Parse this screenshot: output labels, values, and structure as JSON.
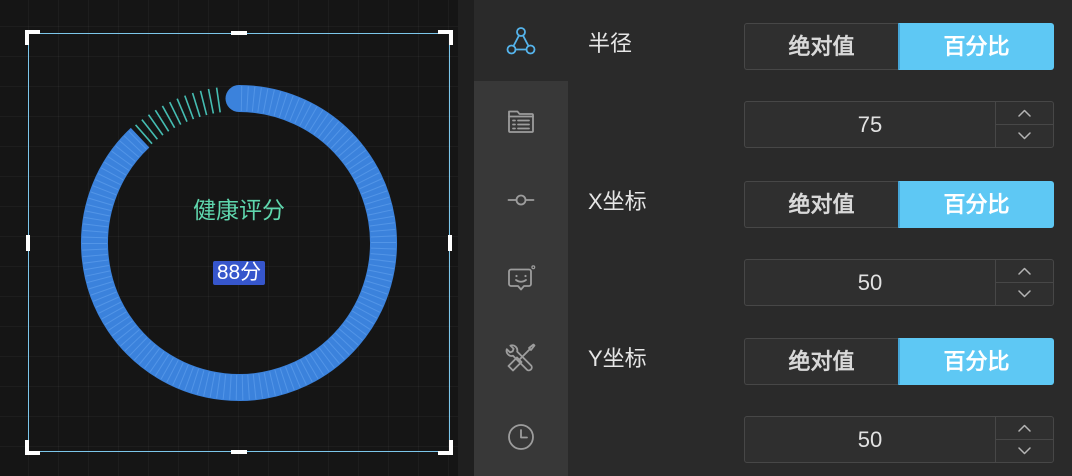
{
  "canvas": {
    "gauge": {
      "label": "健康评分",
      "value_text": "88分",
      "fill_percent": 88,
      "fill_color": "#3b82dc",
      "stripe_color": "#6aa8f2",
      "remainder_color": "#45bdb2",
      "label_color": "#5fd6ad",
      "value_highlight_color": "#3656cc"
    },
    "selection_color": "#7cc6ea"
  },
  "sidebar": {
    "tabs": [
      {
        "icon": "share-nodes-icon",
        "active": true
      },
      {
        "icon": "file-list-icon",
        "active": false
      },
      {
        "icon": "commit-icon",
        "active": false
      },
      {
        "icon": "chat-smile-icon",
        "active": false
      },
      {
        "icon": "tools-icon",
        "active": false
      },
      {
        "icon": "clock-icon",
        "active": false
      }
    ],
    "active_icon_color": "#55b4ec",
    "icon_color": "#9d9d9d"
  },
  "properties": {
    "accent_color": "#5ec8f4",
    "rows": [
      {
        "label": "半径",
        "mode_options": [
          "绝对值",
          "百分比"
        ],
        "selected_index": 1,
        "value": "75"
      },
      {
        "label": "X坐标",
        "mode_options": [
          "绝对值",
          "百分比"
        ],
        "selected_index": 1,
        "value": "50"
      },
      {
        "label": "Y坐标",
        "mode_options": [
          "绝对值",
          "百分比"
        ],
        "selected_index": 1,
        "value": "50"
      }
    ]
  }
}
